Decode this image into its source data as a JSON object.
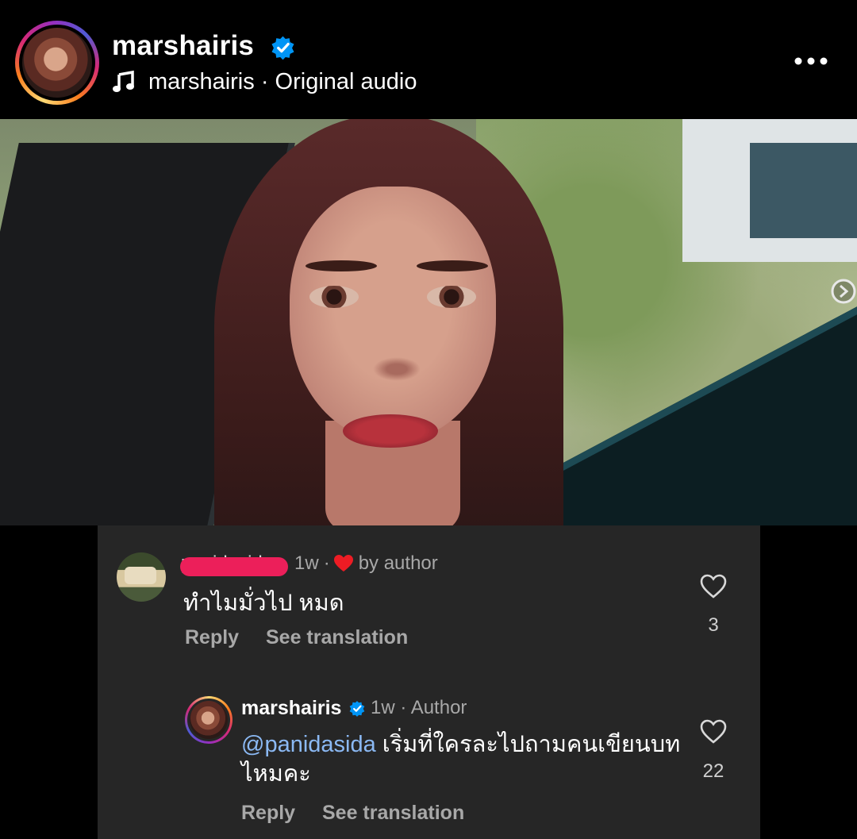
{
  "header": {
    "username": "marshairis",
    "audio_user": "marshairis",
    "audio_separator": "·",
    "audio_label": "Original audio",
    "icons": [
      "verified-badge-icon",
      "music-note-icon",
      "more-options-icon"
    ]
  },
  "video": {
    "icons": [
      "next-arrow-icon"
    ]
  },
  "comments": [
    {
      "username": "panidasida",
      "time": "1w",
      "separator": "·",
      "liked_by_author_label": "by author",
      "text": "ทำไมมั่วไป หมด",
      "reply_label": "Reply",
      "translate_label": "See translation",
      "likes": "3"
    },
    {
      "username": "marshairis",
      "time": "1w",
      "separator": "·",
      "role_label": "Author",
      "mention": "@panidasida",
      "text": "เริ่มที่ใครละไปถามคนเขียนบทไหมคะ",
      "reply_label": "Reply",
      "translate_label": "See translation",
      "likes": "22"
    }
  ],
  "colors": {
    "background": "#000000",
    "comment_panel": "#262626",
    "verified_blue": "#0095f6",
    "heart_red": "#ed4956",
    "mention_blue": "#8bb9f4",
    "redaction_pink": "#ec1f5a"
  }
}
